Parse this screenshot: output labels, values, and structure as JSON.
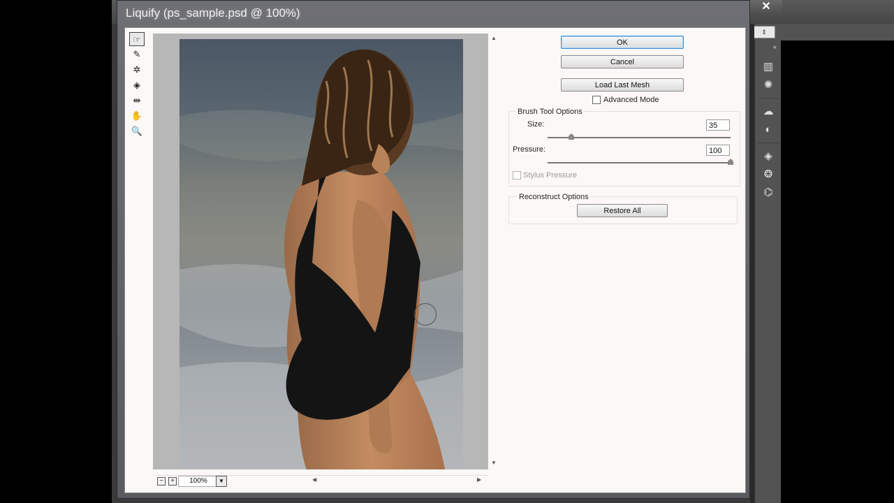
{
  "dialog": {
    "title": "Liquify (ps_sample.psd @ 100%)"
  },
  "app": {
    "close_glyph": "✕",
    "panel_icons": [
      "histogram-icon",
      "brush-settings-icon",
      "creative-cloud-icon",
      "adjustments-icon",
      "layers-icon",
      "channels-icon",
      "paths-icon"
    ]
  },
  "tools": [
    {
      "name": "forward-warp-tool",
      "glyph": "☞",
      "active": true
    },
    {
      "name": "reconstruct-tool",
      "glyph": "✎"
    },
    {
      "name": "pucker-tool",
      "glyph": "✲"
    },
    {
      "name": "bloat-tool",
      "glyph": "◈"
    },
    {
      "name": "push-left-tool",
      "glyph": "⇹"
    },
    {
      "name": "hand-tool",
      "glyph": "✋"
    },
    {
      "name": "zoom-tool",
      "glyph": "🔍"
    }
  ],
  "zoom": {
    "minus": "−",
    "plus": "+",
    "value": "100%"
  },
  "buttons": {
    "ok": "OK",
    "cancel": "Cancel",
    "load_last_mesh": "Load Last Mesh",
    "restore_all": "Restore All"
  },
  "advanced_mode_label": "Advanced Mode",
  "brush": {
    "group_label": "Brush Tool Options",
    "size_label": "Size:",
    "size_value": "35",
    "pressure_label": "Pressure:",
    "pressure_value": "100",
    "stylus_label": "Stylus Pressure",
    "size_fraction": 0.13,
    "pressure_fraction": 1.0
  },
  "reconstruct": {
    "group_label": "Reconstruct Options"
  }
}
